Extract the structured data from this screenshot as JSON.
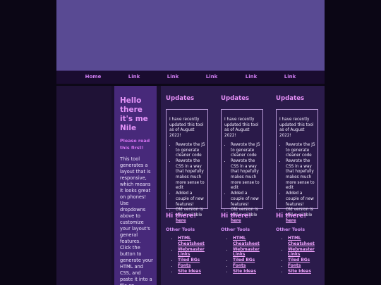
{
  "nav": {
    "items": [
      "Home",
      "Link",
      "Link",
      "Link",
      "Link",
      "Link"
    ]
  },
  "intro": {
    "title": "Hello there it's me Nile",
    "subtitle": "Please read this first!",
    "body": "This tool generates a layout that is responsive, which means it looks great on phones! Use dropdowns above to customize your layout's general features. Click the button to generate your HTML and CSS, and paste it into a file on Neocities."
  },
  "columns": [
    {
      "heading": "Updates",
      "intro": "I have recently updated this tool as of August 2022!",
      "bullets": [
        "Rewrote the JS to generate cleaner code",
        "Rewrote the CSS in a way that hopefully makes much more sense to edit",
        "Added a couple of new features!",
        "Old version is still available"
      ],
      "here_link": "here",
      "hi": "Hi there!",
      "tools_heading": "Other Tools",
      "tools": [
        "HTML Cheatsheet",
        "Webmaster Links",
        "Tiled BGs",
        "Fonts",
        "Site Ideas"
      ]
    },
    {
      "heading": "Updates",
      "intro": "I have recently updated this tool as of August 2022!",
      "bullets": [
        "Rewrote the JS to generate cleaner code",
        "Rewrote the CSS in a way that hopefully makes much more sense to edit",
        "Added a couple of new features!",
        "Old version is still available"
      ],
      "here_link": "here",
      "hi": "Hi there!",
      "tools_heading": "Other Tools",
      "tools": [
        "HTML Cheatsheet",
        "Webmaster Links",
        "Tiled BGs",
        "Fonts",
        "Site Ideas"
      ]
    },
    {
      "heading": "Updates",
      "intro": "I have recently updated this tool as of August 2022!",
      "bullets": [
        "Rewrote the JS to generate cleaner code",
        "Rewrote the CSS in a way that hopefully makes much more sense to edit",
        "Added a couple of new features!",
        "Old version is still available"
      ],
      "here_link": "here",
      "hi": "Hi there!",
      "tools_heading": "Other Tools",
      "tools": [
        "HTML Cheatsheet",
        "Webmaster Links",
        "Tiled BGs",
        "Fonts",
        "Site Ideas"
      ]
    }
  ],
  "colors": {
    "header": "#594a93",
    "nav_link": "#ce7cf0",
    "intro_panel": "#47297a",
    "main_panel": "#2b1b4b",
    "heading": "#e58ff7",
    "box_border": "#b99ad8"
  }
}
